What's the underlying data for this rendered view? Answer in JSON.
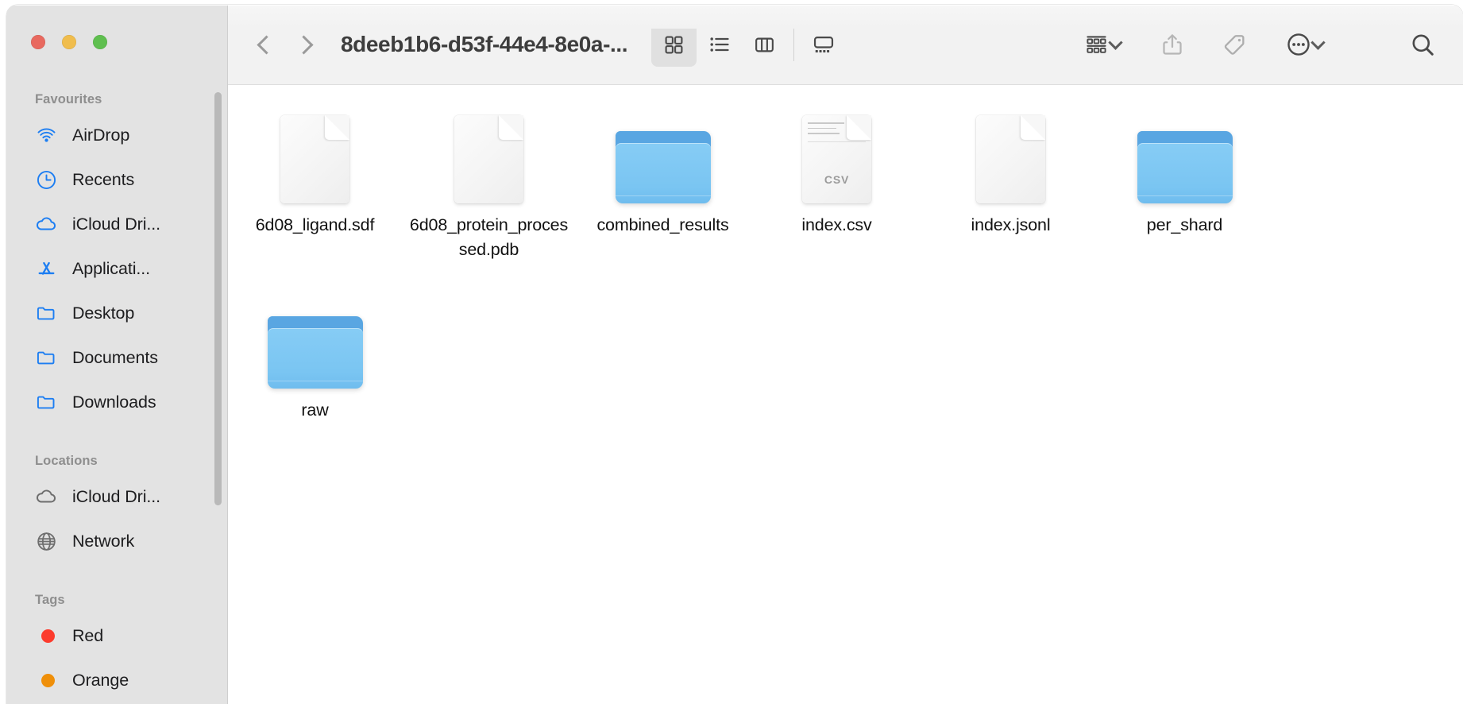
{
  "window": {
    "title": "8deeb1b6-d53f-44e4-8e0a-...",
    "traffic_lights": [
      {
        "name": "close",
        "color": "#e8695f"
      },
      {
        "name": "minimize",
        "color": "#f0bd4d"
      },
      {
        "name": "zoom",
        "color": "#5fbf4f"
      }
    ]
  },
  "toolbar": {
    "back_label": "Back",
    "forward_label": "Forward",
    "view_buttons": [
      {
        "name": "icon-view",
        "label": "as Icons",
        "active": true
      },
      {
        "name": "list-view",
        "label": "as List",
        "active": false
      },
      {
        "name": "column-view",
        "label": "as Columns",
        "active": false
      },
      {
        "name": "gallery-view",
        "label": "as Gallery",
        "active": false
      }
    ],
    "group_label": "Group",
    "share_label": "Share",
    "tags_label": "Tags",
    "more_label": "More",
    "search_label": "Search"
  },
  "sidebar": {
    "sections": [
      {
        "title": "Favourites",
        "items": [
          {
            "label": "AirDrop",
            "icon": "airdrop-icon"
          },
          {
            "label": "Recents",
            "icon": "clock-icon"
          },
          {
            "label": "iCloud Dri...",
            "icon": "cloud-icon"
          },
          {
            "label": "Applicati...",
            "icon": "appstore-icon"
          },
          {
            "label": "Desktop",
            "icon": "folder-icon"
          },
          {
            "label": "Documents",
            "icon": "folder-icon"
          },
          {
            "label": "Downloads",
            "icon": "folder-icon"
          }
        ]
      },
      {
        "title": "Locations",
        "items": [
          {
            "label": "iCloud Dri...",
            "icon": "cloud-icon"
          },
          {
            "label": "Network",
            "icon": "globe-icon"
          }
        ]
      },
      {
        "title": "Tags",
        "items": [
          {
            "label": "Red",
            "icon": "tag-dot",
            "color": "#fc3b2d"
          },
          {
            "label": "Orange",
            "icon": "tag-dot",
            "color": "#ef8f09"
          }
        ]
      }
    ]
  },
  "files": {
    "row1": [
      {
        "name": "6d08_ligand.sdf",
        "kind": "document",
        "badge": ""
      },
      {
        "name": "6d08_protein_processed.pdb",
        "kind": "document",
        "badge": ""
      },
      {
        "name": "combined_results",
        "kind": "folder",
        "badge": ""
      },
      {
        "name": "index.csv",
        "kind": "document",
        "badge": "CSV"
      },
      {
        "name": "index.jsonl",
        "kind": "document",
        "badge": ""
      },
      {
        "name": "per_shard",
        "kind": "folder",
        "badge": ""
      }
    ],
    "row2": [
      {
        "name": "raw",
        "kind": "folder",
        "badge": ""
      }
    ]
  },
  "colors": {
    "sidebar_bg": "#e3e3e3",
    "toolbar_bg": "#f2f2f2",
    "accent_blue": "#0a84ff",
    "folder_blue": "#7ac5f2"
  }
}
